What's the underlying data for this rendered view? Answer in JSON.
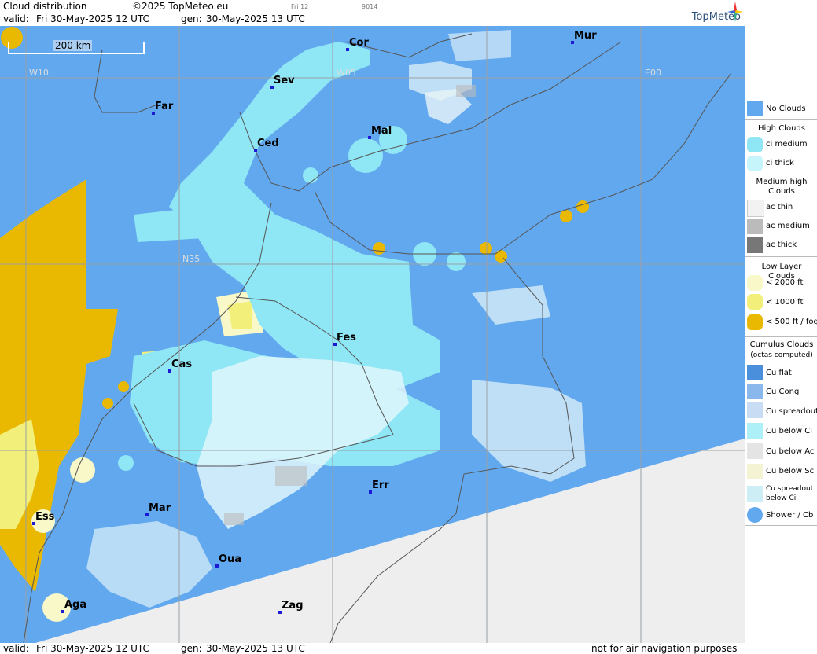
{
  "header": {
    "title": "Cloud distribution",
    "copyright": "©2025 TopMeteo.eu",
    "code1": "Fri 12",
    "code2": "9014",
    "valid_label": "valid:",
    "valid_value": "Fri  30-May-2025  12 UTC",
    "gen_label": "gen:",
    "gen_value": "30-May-2025 13 UTC",
    "logo": "TopMeteo"
  },
  "map": {
    "scale_label": "200 km",
    "grid_labels": [
      "W10",
      "W05",
      "E00",
      "N35"
    ],
    "cities": [
      "Cor",
      "Mur",
      "Sev",
      "Far",
      "Ced",
      "Mal",
      "Fes",
      "Cas",
      "Err",
      "Mar",
      "Ess",
      "Oua",
      "Aga",
      "Zag"
    ]
  },
  "legend": {
    "no_clouds": "No Clouds",
    "high_title": "High Clouds",
    "ci_medium": "ci medium",
    "ci_thick": "ci thick",
    "medium_title": "Medium high Clouds",
    "ac_thin": "ac thin",
    "ac_medium": "ac medium",
    "ac_thick": "ac thick",
    "low_title": "Low Layer Clouds",
    "lt2000": "< 2000 ft",
    "lt1000": "< 1000 ft",
    "lt500": "< 500 ft / fog",
    "cu_title": "Cumulus Clouds",
    "cu_sub": "(octas computed)",
    "cu_flat": "Cu flat",
    "cu_cong": "Cu Cong",
    "cu_spread": "Cu spreadout",
    "cu_below_ci": "Cu below Ci",
    "cu_below_ac": "Cu below Ac",
    "cu_below_sc": "Cu below Sc",
    "cu_spread_ci": "Cu spreadout below Ci",
    "shower": "Shower / Cb"
  },
  "footer": {
    "valid_label": "valid:",
    "valid_value": "Fri  30-May-2025  12 UTC",
    "gen_label": "gen:",
    "gen_value": "30-May-2025 13 UTC",
    "note": "not for air navigation purposes"
  },
  "colors": {
    "sea": "#62a8ee",
    "ci_medium": "#8fe6f4",
    "ci_thick": "#c6f6fc",
    "fog": "#e9b800",
    "low1000": "#f2f07a",
    "low2000": "#f8f8c8",
    "no_data": "#eeeeee"
  }
}
